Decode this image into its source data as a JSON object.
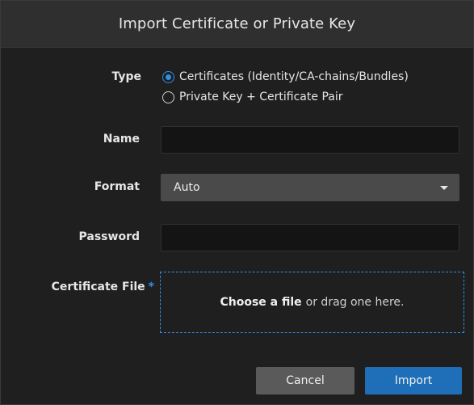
{
  "dialog": {
    "title": "Import Certificate or Private Key"
  },
  "type": {
    "label": "Type",
    "options": [
      {
        "label": "Certificates (Identity/CA-chains/Bundles)",
        "selected": true
      },
      {
        "label": "Private Key + Certificate Pair",
        "selected": false
      }
    ]
  },
  "name": {
    "label": "Name",
    "value": ""
  },
  "format": {
    "label": "Format",
    "selected": "Auto"
  },
  "password": {
    "label": "Password",
    "value": ""
  },
  "certificate_file": {
    "label": "Certificate File",
    "required_marker": "*",
    "choose_text": "Choose a file",
    "drag_text": "or drag one here."
  },
  "buttons": {
    "cancel": "Cancel",
    "import": "Import"
  },
  "colors": {
    "accent": "#2f8fe5",
    "primary_button": "#1f6fb8",
    "secondary_button": "#5a5a5a",
    "background": "#1f1f1f",
    "header": "#2f2f2f"
  },
  "icons": {
    "radio_selected": "radio-checked-icon",
    "radio_unselected": "radio-unchecked-icon",
    "dropdown": "caret-down-icon"
  }
}
